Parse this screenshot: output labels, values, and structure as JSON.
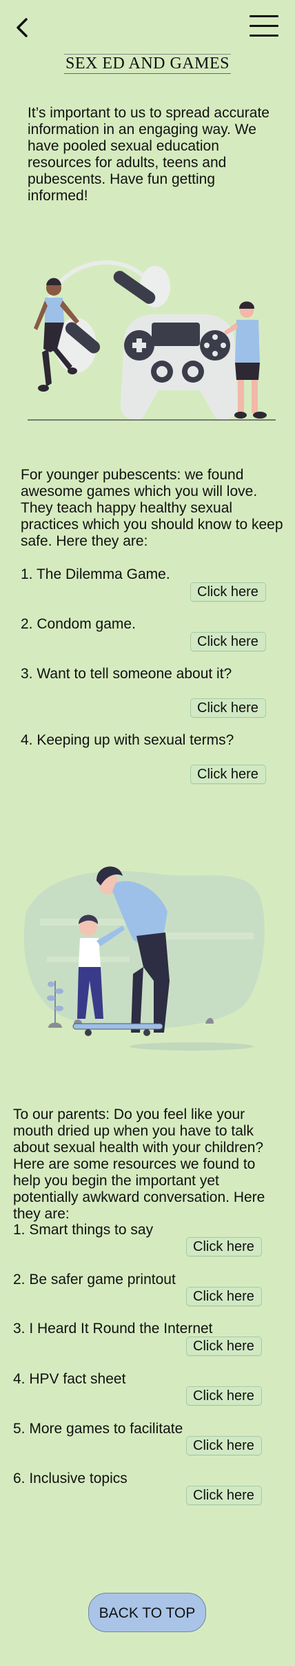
{
  "header": {
    "title": "SEX ED AND GAMES"
  },
  "intro": "It’s important to us to spread accurate information in an engaging way. We have pooled sexual education resources for adults, teens and pubescents. Have fun getting informed!",
  "younger": {
    "text": "For younger pubescents: we found awesome games which you will love. They teach happy healthy sexual practices which you should know to keep safe. Here they are:",
    "items": [
      {
        "label": "1. The Dilemma Game.",
        "link": "Click here"
      },
      {
        "label": "2. Condom game.",
        "link": "Click here"
      },
      {
        "label": "3. Want to tell someone about it?",
        "link": "Click here"
      },
      {
        "label": "4. Keeping up with sexual terms?",
        "link": "Click here"
      }
    ]
  },
  "parents": {
    "text": "To our parents: Do you feel like your mouth dried up when you have to talk about sexual health with your children? Here are some resources we found to help you begin the important yet potentially awkward conversation. Here they are:",
    "items": [
      {
        "label": "1. Smart things to say",
        "link": "Click here"
      },
      {
        "label": "2. Be safer game printout",
        "link": "Click here"
      },
      {
        "label": "3. I Heard It Round the Internet",
        "link": "Click here"
      },
      {
        "label": "4. HPV fact sheet",
        "link": "Click here"
      },
      {
        "label": "5. More games to facilitate",
        "link": "Click here"
      },
      {
        "label": "6. Inclusive topics",
        "link": "Click here"
      }
    ]
  },
  "footer": {
    "back_to_top": "BACK TO TOP"
  },
  "colors": {
    "background": "#d5ebbf",
    "button": "#a9c4e7",
    "link_bg": "#d0e9c3",
    "accent_blue": "#9dc0e8"
  },
  "icons": [
    "back-chevron-icon",
    "hamburger-menu-icon"
  ]
}
